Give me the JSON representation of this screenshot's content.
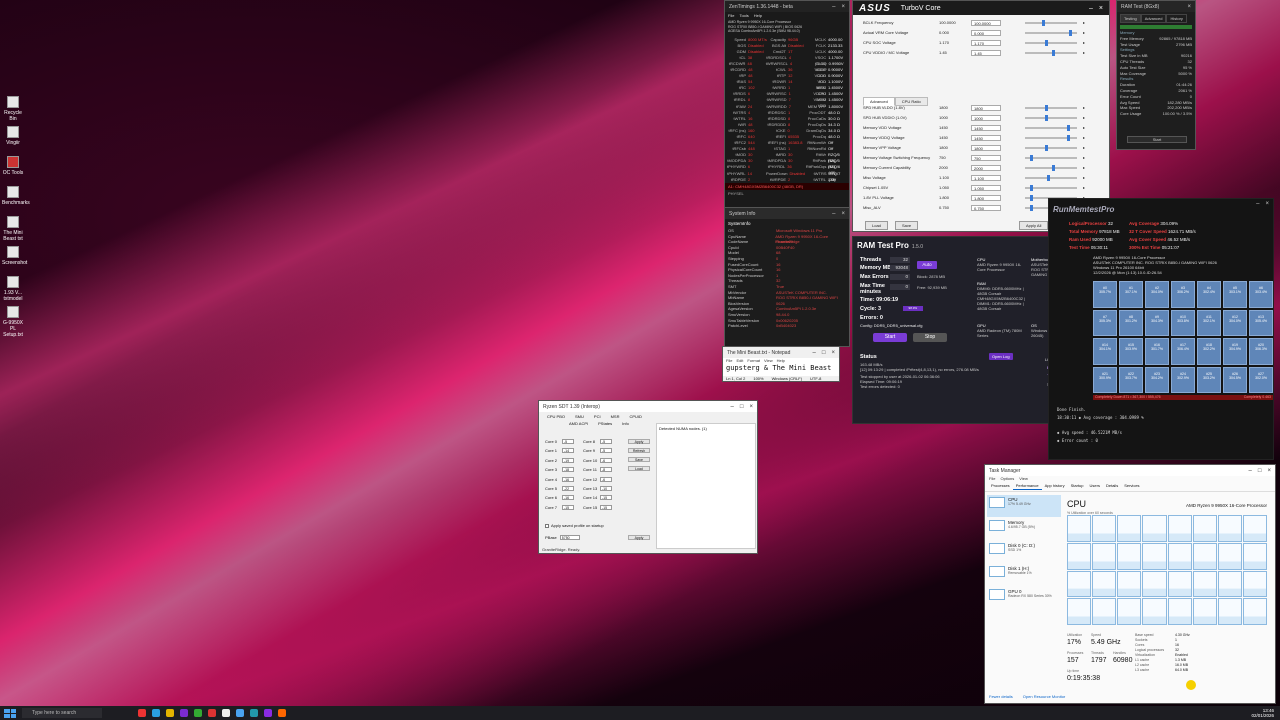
{
  "desktop": {
    "icons": [
      "Recycle Bin",
      "Vingiir",
      "OC Tools",
      "Benchmarks",
      "The Mini Beast txt",
      "Screenshot",
      "1.93 V... txtmodel",
      "G-9950X PL Setup.txt"
    ]
  },
  "zentimings": {
    "title": "ZenTimings 1.36.1448 - beta",
    "menu": [
      "File",
      "Tools",
      "Help"
    ],
    "header": [
      "AMD Ryzen 9 9950X 16-Core Processor",
      "ROG STRIX B850-I GAMING WIFI | BIOS 0626",
      "AGESA ComboAm5Pi 1.2.0.3e (SMU 98.44.0)"
    ],
    "rows": [
      [
        "Speed",
        "8000 MT/s",
        "Capacity",
        "96GB",
        "MCLK",
        "4000.00"
      ],
      [
        "BGS",
        "Disabled",
        "BGS Alt",
        "Disabled",
        "FCLK",
        "2133.33"
      ],
      [
        "GDM",
        "Disabled",
        "Cmd2T",
        "1T",
        "UCLK",
        "4000.00"
      ],
      [
        "tCL",
        "38",
        "tRDRDSCL",
        "4",
        "VSOC (SVI3)",
        "1.1700V"
      ],
      [
        "tRCDWR",
        "48",
        "tWRWRSCL",
        "4",
        "CLDO VDDP",
        "0.9950V"
      ],
      [
        "tRCDRD",
        "48",
        "tCWL",
        "36",
        "VDDG CCD",
        "0.9000V"
      ],
      [
        "tRP",
        "48",
        "tRTP",
        "12",
        "VDDG IOD",
        "0.9000V"
      ],
      [
        "tRAS",
        "54",
        "tRDWR",
        "14",
        "VDD MISC",
        "1.1000V"
      ],
      [
        "tRC",
        "102",
        "tWRRD",
        "1",
        "MEM VDDIO",
        "1.4500V"
      ],
      [
        "tRRDS",
        "6",
        "tWRWRSC",
        "1",
        "CPU VDDIO",
        "1.4500V"
      ],
      [
        "tRRDL",
        "8",
        "tWRWRSD",
        "7",
        "MEM VDD",
        "1.4500V"
      ],
      [
        "tFAW",
        "24",
        "tWRWRDD",
        "7",
        "MEM VPP",
        "1.8000V"
      ],
      [
        "tWTRS",
        "4",
        "tRDRDSC",
        "1",
        "ProcODT",
        "48.0 Ω"
      ],
      [
        "tWTRL",
        "16",
        "tRDRDSD",
        "8",
        "ProcCaDs",
        "30.0 Ω"
      ],
      [
        "tWR",
        "48",
        "tRDRDDD",
        "8",
        "ProcDqDs",
        "34.3 Ω"
      ],
      [
        "tRFC (ns)",
        "160",
        "tCKE",
        "0",
        "DramDqDs",
        "34.0 Ω"
      ],
      [
        "tRFC",
        "640",
        "tREFI",
        "65535",
        "ProcDq",
        "48.0 Ω"
      ],
      [
        "tRFC2",
        "544",
        "tREFI (ns)",
        "16383.8",
        "RttNomWr",
        "Off"
      ],
      [
        "tRFCsb",
        "448",
        "tSTAG",
        "1",
        "RttNomRd",
        "Off"
      ],
      [
        "tMOD",
        "30",
        "tMRD",
        "30",
        "RttWr",
        "RZQ/5 (48)"
      ],
      [
        "tMODPDA",
        "30",
        "tMRDPDA",
        "30",
        "RttPark",
        "RZQ/5 (48)"
      ],
      [
        "tPHYWRD",
        "6",
        "tPHYRDL",
        "36",
        "RttParkDqs",
        "RZQ/6 (40)"
      ],
      [
        "tPHYWRL",
        "14",
        "PowerDown",
        "Disabled",
        "tWTRS",
        "RZQ/7 (34)"
      ],
      [
        "tRDPDE",
        "2",
        "tWRPDE",
        "2",
        "tWTRL",
        "1.0V"
      ]
    ],
    "footer": "A1: CMH48GX5M2B6400C32 (48GB, DR)",
    "tab": "PHYSEL"
  },
  "system_info": {
    "title": "System Info",
    "section": "SystemInfo",
    "rows": [
      [
        "OS",
        "Microsoft Windows 11 Pro"
      ],
      [
        "CpuName",
        "AMD Ryzen 9 9950X 16-Core Processor"
      ],
      [
        "CodeName",
        "GraniteRidge"
      ],
      [
        "CpuId",
        "00B40F40"
      ],
      [
        "Model",
        "68"
      ],
      [
        "Stepping",
        "0"
      ],
      [
        "FusedCoreCount",
        "16"
      ],
      [
        "PhysicalCoreCount",
        "16"
      ],
      [
        "NodesPerProcessor",
        "1"
      ],
      [
        "Threads",
        "32"
      ],
      [
        "SMT",
        "True"
      ],
      [
        "MbVendor",
        "ASUSTeK COMPUTER INC."
      ],
      [
        "MbName",
        "ROG STRIX B850-I GAMING WIFI"
      ],
      [
        "BiosVersion",
        "0626"
      ],
      [
        "AgesaVersion",
        "ComboAm5Pi 1.2.0.3e"
      ],
      [
        "SmuVersion",
        "98.44.0"
      ],
      [
        "SmuTableVersion",
        "0x00620205"
      ],
      [
        "PatchLevel",
        "0xB404023"
      ]
    ]
  },
  "turbov": {
    "brand": "ASUS",
    "title": "TurboV Core",
    "top_rows": [
      [
        "BCLK Frequency",
        "100.0000",
        "100.0000",
        0.35
      ],
      [
        "Actual VRM Core Voltage",
        "0.000",
        "0.000",
        0.9
      ],
      [
        "CPU SOC Voltage",
        "1.170",
        "1.170",
        0.4
      ],
      [
        "CPU VDDIO / MC Voltage",
        "1.45",
        "1.45",
        0.55
      ]
    ],
    "tabs": [
      "Advanced",
      "CPU Ratio"
    ],
    "adv_rows": [
      [
        "SPD HUB VLDO (1.8V)",
        "1800",
        "1800",
        0.4
      ],
      [
        "SPD HUB VDDIO (1.0V)",
        "1000",
        "1000",
        0.4
      ],
      [
        "Memory VDD Voltage",
        "1450",
        "1450",
        0.85
      ],
      [
        "Memory VDDQ Voltage",
        "1450",
        "1450",
        0.85
      ],
      [
        "Memory VPP Voltage",
        "1800",
        "1800",
        0.4
      ],
      [
        "Memory Voltage Switching Frequency",
        "750",
        "750",
        0.1
      ],
      [
        "Memory Current Capability",
        "2000",
        "2000",
        0.55
      ],
      [
        "Misc Voltage",
        "1.100",
        "1.100",
        0.45
      ],
      [
        "Chipset 1.05V",
        "1.050",
        "1.050",
        0.1
      ],
      [
        "1.8V PLL Voltage",
        "1.800",
        "1.800",
        0.1
      ],
      [
        "Misc_ALV",
        "0.750",
        "0.750",
        0.1
      ]
    ],
    "buttons": {
      "load": "Load",
      "save": "Save",
      "apply": "Apply All"
    }
  },
  "ramtest_small": {
    "title": "RAM Test (8Gx8)",
    "tabs": [
      "Testing",
      "Advanced",
      "History"
    ],
    "rows": [
      [
        "Memory",
        ""
      ],
      [
        "Free Memory",
        "92865 / 97818 MB"
      ],
      [
        "Test Usage",
        "2796 MB"
      ],
      [
        "Settings",
        ""
      ],
      [
        "Test Size in MB",
        "90216"
      ],
      [
        "CPU Threads",
        "32"
      ],
      [
        "Auto Test Size",
        "95 %"
      ],
      [
        "Max Coverage",
        "5000 %"
      ],
      [
        "Results",
        ""
      ],
      [
        "Duration",
        "01:44:26"
      ],
      [
        "Coverage",
        "2061 %"
      ],
      [
        "Error Count",
        "0"
      ],
      [
        "Avg Speed",
        "182,280 MB/s"
      ],
      [
        "Max Speed",
        "202,200 MB/s"
      ],
      [
        "Core Usage",
        "100.00 % / 3.5%"
      ]
    ],
    "start": "Start"
  },
  "ramtestpro": {
    "title": "RAM Test Pro",
    "version": "1.5.0",
    "threads_label": "Threads",
    "threads": "32",
    "memory_label": "Memory MB",
    "memory": "93048",
    "auto": "Auto",
    "maxerr_label": "Max Errors",
    "maxerr": "0",
    "block": "Block: 2878 MB",
    "maxtime_label": "Max Time minutes",
    "maxtime": "0",
    "free": "Free: 92,939 MB",
    "time": "Time: 09:06:19",
    "cycle": "Cycle: 3",
    "cycle_pct": "98.3%",
    "errors": "Errors: 0",
    "config": "Config: DDR5_DDR5_universal.cfg",
    "start": "Start",
    "stop": "Stop",
    "cpu_label": "CPU",
    "cpu": "AMD Ryzen 9 9950X 16-Core Processor",
    "mb_label": "Motherboard",
    "mb": "ASUSTeK COMPUTER INC. ROG STRIX B850-I GAMING WIFI (0626)",
    "ram_label": "RAM",
    "ram": "DIMM0: DDR5-6600MHz | 48GB Corsair CMH48GX5M2B6400C32 | DIMM1: DDR5-6600MHz | 48GB Corsair",
    "gpu_label": "GPU",
    "gpu": "AMD Radeon (TM) 780M Series",
    "os_label": "OS",
    "os": "Windows 10 Pro (Build 26045)",
    "status_label": "Status",
    "open_log": "Open Log",
    "status_lines": [
      "163.48 MB/s",
      "[12] 09:13:29 | completed /Prftest(4,8,13,1), no errors, 276.08 MB/s",
      "Test stopped by user at 2026-01-02 06:36:06",
      "Elapsed Time: 09:06:19",
      "Test errors detected: 0"
    ],
    "license": "License: Free",
    "links": [
      "Benchmark",
      "Test Config"
    ],
    "promo": "promo.k.ru"
  },
  "notepad": {
    "title": "The Mini Beast.txt - Notepad",
    "menu": [
      "File",
      "Edit",
      "Format",
      "View",
      "Help"
    ],
    "text": "gupsterg & The Mini Beast",
    "status": [
      "Ln 1, Col 2",
      "100%",
      "Windows (CRLF)",
      "UTF-8"
    ]
  },
  "pbo2": {
    "title": "Ryzen SDT 1.39 (Interop)",
    "tabs": [
      "CPU PBO",
      "SMU",
      "PCI",
      "MSR",
      "CPUID"
    ],
    "subtabs": [
      "AMD ACPI",
      "PStates",
      "Info"
    ],
    "cores": [
      [
        "Core 0",
        "-5"
      ],
      [
        "Core 1",
        "-14"
      ],
      [
        "Core 2",
        "-19"
      ],
      [
        "Core 3",
        "-18"
      ],
      [
        "Core 4",
        "-16"
      ],
      [
        "Core 5",
        "-22"
      ],
      [
        "Core 6",
        "-16"
      ],
      [
        "Core 7",
        "-15"
      ],
      [
        "Core 8",
        "-5"
      ],
      [
        "Core 9",
        "-5"
      ],
      [
        "Core 10",
        "-6"
      ],
      [
        "Core 11",
        "-8"
      ],
      [
        "Core 12",
        "-6"
      ],
      [
        "Core 13",
        "-10"
      ],
      [
        "Core 14",
        "-15"
      ],
      [
        "Core 15",
        "-15"
      ]
    ],
    "buttons": [
      "Apply",
      "Refresh",
      "Save",
      "Load"
    ],
    "startup": "Apply saved profile on startup",
    "ppt_label": "PBase",
    "ppt": "5750",
    "apply2": "Apply",
    "log": "Detected NUMA nodes. (1)",
    "status": "GraniteRidge. Ready."
  },
  "runmemtest": {
    "logo": "RunMemtestPro",
    "stats": [
      [
        "LogicalProcessor",
        "32"
      ],
      [
        "Total Memory",
        "97818 MB"
      ],
      [
        "Ram Used",
        "92000 MB"
      ],
      [
        "Test Time",
        "05:30:11"
      ],
      [
        "Avg Coverage",
        "304.09%"
      ],
      [
        "32 T Cover Speed",
        "1624.71 MB/s"
      ],
      [
        "Avg Cover Speed",
        "46.52 MB/s"
      ],
      [
        "300% Est Time",
        "05:21:07"
      ]
    ],
    "info": [
      "AMD Ryzen 9 9950X 16-Core Processor",
      "ASUSTeK COMPUTER INC. ROG STRIX B850-I GAMING WIFI 0626",
      "Windows 11 Pro 26100 64bit",
      "12/2/2026 @ Mon (1:13) 10.0-ID:26.54"
    ],
    "cells": [
      "#0",
      "#1",
      "#2",
      "#3",
      "#4",
      "#5",
      "#6",
      "#7",
      "#8",
      "#9",
      "#10",
      "#11",
      "#12",
      "#13",
      "#14",
      "#15",
      "#16",
      "#17",
      "#18",
      "#19",
      "#20",
      "#21",
      "#22",
      "#23",
      "#24",
      "#25",
      "#26",
      "#27"
    ],
    "cell_pcts": [
      "305.7%",
      "307.1%",
      "304.0%",
      "306.2%",
      "302.4%",
      "303.1%",
      "303.4%",
      "305.3%",
      "301.2%",
      "304.3%",
      "303.8%",
      "302.1%",
      "304.0%",
      "305.4%",
      "304.1%",
      "303.9%",
      "301.7%",
      "306.4%",
      "302.2%",
      "304.9%",
      "306.3%",
      "300.9%",
      "303.7%",
      "304.2%",
      "302.9%",
      "303.2%",
      "304.5%",
      "302.0%"
    ],
    "footer": "Completely Down 871 • 367,300 / 555,476",
    "log": [
      "Done Finish.",
      "18:30:11 ◆ Avg coverage : 304.0989 %",
      "◆ Avg speed : 46.5221M MB/s",
      "◆ Error count : 0"
    ],
    "brand": "Completely 0.463"
  },
  "taskmgr": {
    "title": "Task Manager",
    "menu": [
      "File",
      "Options",
      "View"
    ],
    "tabs": [
      "Processes",
      "Performance",
      "App history",
      "Startup",
      "Users",
      "Details",
      "Services"
    ],
    "side": [
      [
        "CPU",
        "17% 5.49 GHz"
      ],
      [
        "Memory",
        "4.6/95.7 GB (5%)"
      ],
      [
        "Disk 0 (C: D:)",
        "SSD 1%"
      ],
      [
        "Disk 1 (H:)",
        "Removable 1%"
      ],
      [
        "GPU 0",
        "Radeon RX 580 Series 30%"
      ]
    ],
    "cpu_title": "CPU",
    "cpu_name": "AMD Ryzen 9 9950X 16-Core Processor",
    "graph_label": "% Utilization over 60 seconds",
    "utilization_label": "Utilization",
    "utilization": "17%",
    "speed_label": "Speed",
    "speed": "5.49 GHz",
    "processes_label": "Processes",
    "processes": "157",
    "threads_label": "Threads",
    "threads": "1797",
    "handles_label": "Handles",
    "handles": "60980",
    "uptime_label": "Up time",
    "uptime": "0:19:35:38",
    "details": [
      [
        "Base speed",
        "4.30 GHz"
      ],
      [
        "Sockets",
        "1"
      ],
      [
        "Cores",
        "16"
      ],
      [
        "Logical processors",
        "32"
      ],
      [
        "Virtualization",
        "Enabled"
      ],
      [
        "L1 cache",
        "1.3 MB"
      ],
      [
        "L2 cache",
        "16.0 MB"
      ],
      [
        "L3 cache",
        "64.0 MB"
      ]
    ],
    "fewer": "Fewer details",
    "monitor": "Open Resource Monitor"
  },
  "taskbar": {
    "search": "Type here to search",
    "time": "13:46",
    "date": "02/01/2026",
    "app_colors": [
      "#e33",
      "#2aa0e0",
      "#e4b400",
      "#7b2bd0",
      "#3a3",
      "#d33",
      "#eee",
      "#4aa3f0",
      "#29a",
      "#8a2be2",
      "#f60"
    ]
  }
}
